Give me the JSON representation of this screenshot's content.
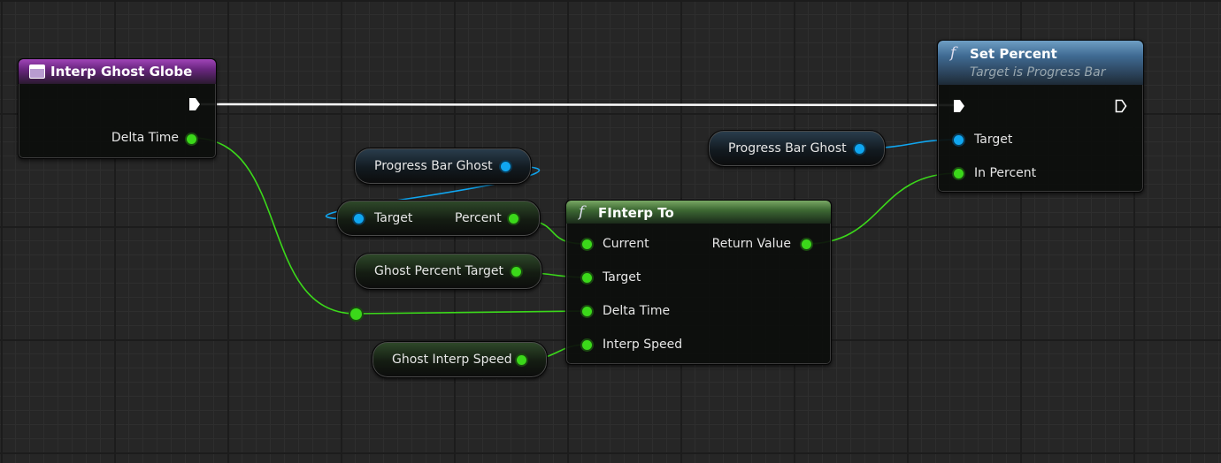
{
  "nodes": {
    "event": {
      "title": "Interp Ghost Globe",
      "pins": {
        "delta_time": "Delta Time"
      }
    },
    "set_percent": {
      "icon": "f",
      "title": "Set Percent",
      "subtitle": "Target is Progress Bar",
      "pins": {
        "target": "Target",
        "in_percent": "In Percent"
      }
    },
    "finterp": {
      "icon": "f",
      "title": "FInterp To",
      "pins": {
        "current": "Current",
        "target": "Target",
        "delta_time": "Delta Time",
        "interp_speed": "Interp Speed",
        "return_value": "Return Value"
      }
    },
    "var_progress_bar_ghost_1": {
      "label": "Progress Bar Ghost"
    },
    "var_progress_bar_ghost_2": {
      "label": "Progress Bar Ghost"
    },
    "get_percent": {
      "target": "Target",
      "percent": "Percent"
    },
    "var_ghost_percent_target": {
      "label": "Ghost Percent Target"
    },
    "var_ghost_interp_speed": {
      "label": "Ghost Interp Speed"
    }
  },
  "colors": {
    "exec_wire": "#ffffff",
    "float_wire": "#3bd81a",
    "object_wire": "#10a6f0",
    "event_header": "#6a2680",
    "function_header": "#3f6a92",
    "pure_function_header": "#3e6a34"
  }
}
